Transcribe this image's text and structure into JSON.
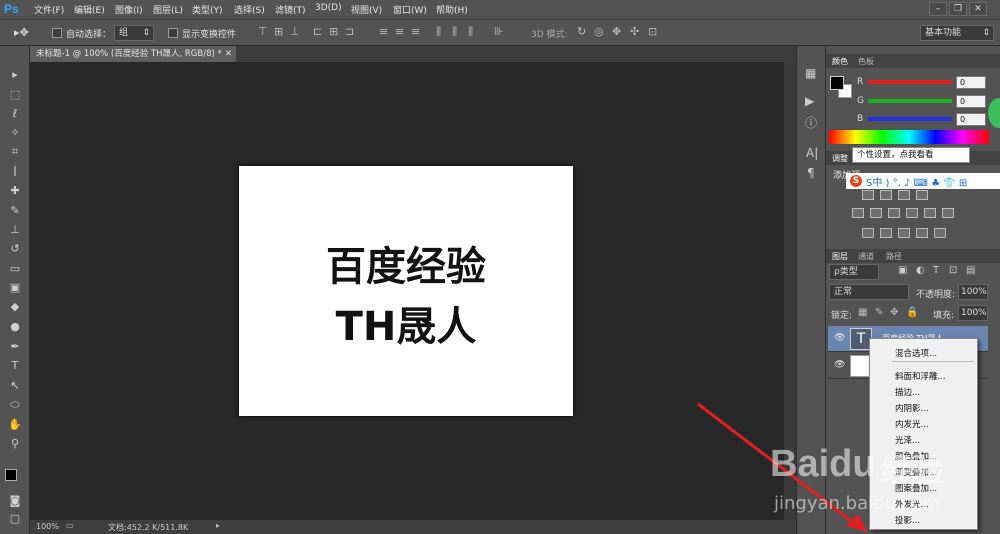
{
  "app": {
    "logo": "Ps"
  },
  "menubar": {
    "items": [
      "文件(F)",
      "编辑(E)",
      "图像(I)",
      "图层(L)",
      "类型(Y)",
      "选择(S)",
      "滤镜(T)",
      "3D(D)",
      "视图(V)",
      "窗口(W)",
      "帮助(H)"
    ],
    "window_buttons": [
      "–",
      "❐",
      "✕"
    ]
  },
  "options_bar": {
    "auto_select_label": "自动选择：",
    "auto_select_value": "组",
    "show_transform_label": "显示变换控件",
    "mode_3d_label": "3D 模式:",
    "workspace_value": "基本功能"
  },
  "document": {
    "tab_title": "未标题-1 @ 100% (百度经验 TH晟人, RGB/8) *",
    "line1": "百度经验",
    "line2": "TH晟人"
  },
  "status": {
    "zoom": "100%",
    "doc_info": "文档:452.2 K/511.8K"
  },
  "color_panel": {
    "tabs": [
      "颜色",
      "色板"
    ],
    "channels": [
      {
        "label": "R",
        "value": "0",
        "color": "#e02020"
      },
      {
        "label": "G",
        "value": "0",
        "color": "#20b020"
      },
      {
        "label": "B",
        "value": "0",
        "color": "#2030e0"
      }
    ]
  },
  "tooltip": {
    "text": "个性设置，点我看看"
  },
  "adjust_panel": {
    "tab": "调整",
    "add_label": "添加调",
    "ime_text": "S中 ) °, ♪ ⌨ ♣ 👕 ⊞"
  },
  "layers_panel": {
    "tabs": [
      "图层",
      "通道",
      "路径"
    ],
    "filter_label": "ρ类型",
    "blend_mode": "正常",
    "opacity_label": "不透明度:",
    "opacity_value": "100%",
    "lock_label": "锁定:",
    "fill_label": "填充:",
    "fill_value": "100%",
    "layers": [
      {
        "name": "百度经验 TH晟人",
        "type": "T"
      },
      {
        "name": "",
        "type": "bg"
      }
    ]
  },
  "context_menu": {
    "items": [
      "混合选项...",
      "斜面和浮雕...",
      "描边...",
      "内阴影...",
      "内发光...",
      "光泽...",
      "颜色叠加...",
      "渐变叠加...",
      "图案叠加...",
      "外发光...",
      "投影..."
    ]
  },
  "watermark": {
    "brand": "Baidu",
    "brand_suffix": "经验",
    "url": "jingyan.baidu.com"
  },
  "colors": {
    "ui_bg": "#535353",
    "canvas_bg": "#282828",
    "arrow": "#e02020",
    "ps_blue": "#31a8ff"
  }
}
